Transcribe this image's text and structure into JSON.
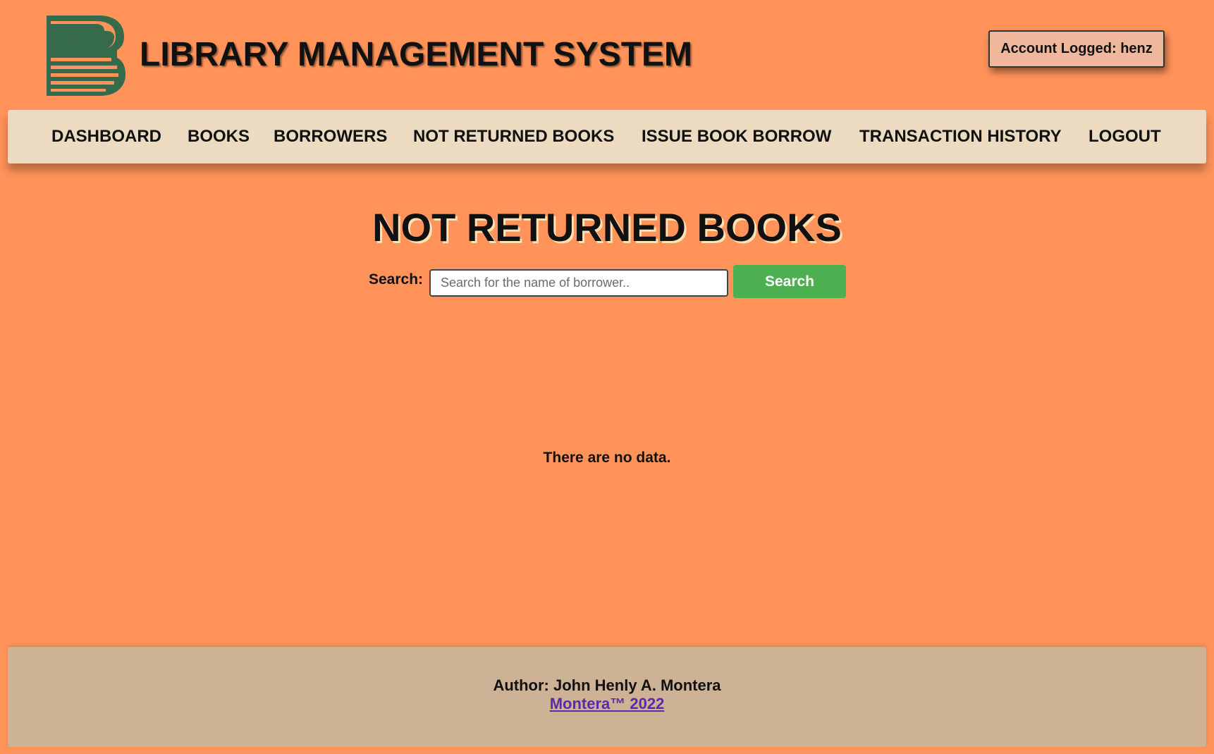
{
  "header": {
    "app_title": "LIBRARY MANAGEMENT SYSTEM",
    "account_label": "Account Logged: henz",
    "logo_icon": "library-book-logo",
    "logo_colors": {
      "primary": "#356b4a"
    }
  },
  "nav": {
    "items": [
      {
        "label": "DASHBOARD"
      },
      {
        "label": "BOOKS"
      },
      {
        "label": "BORROWERS"
      },
      {
        "label": "NOT RETURNED BOOKS"
      },
      {
        "label": "ISSUE BOOK BORROW"
      },
      {
        "label": "TRANSACTION HISTORY"
      },
      {
        "label": "LOGOUT"
      }
    ]
  },
  "main": {
    "title": "NOT RETURNED BOOKS",
    "search_label": "Search:",
    "search_placeholder": "Search for the name of borrower..",
    "search_value": "",
    "search_button": "Search",
    "empty_message": "There are no data."
  },
  "footer": {
    "author": "Author: John Henly A. Montera",
    "copyright": "Montera™ 2022"
  },
  "colors": {
    "background": "#ff9359",
    "nav_background": "#ecdbc1",
    "footer_background": "#ceb295",
    "search_button": "#4caf50",
    "account_box": "#efb89d"
  }
}
